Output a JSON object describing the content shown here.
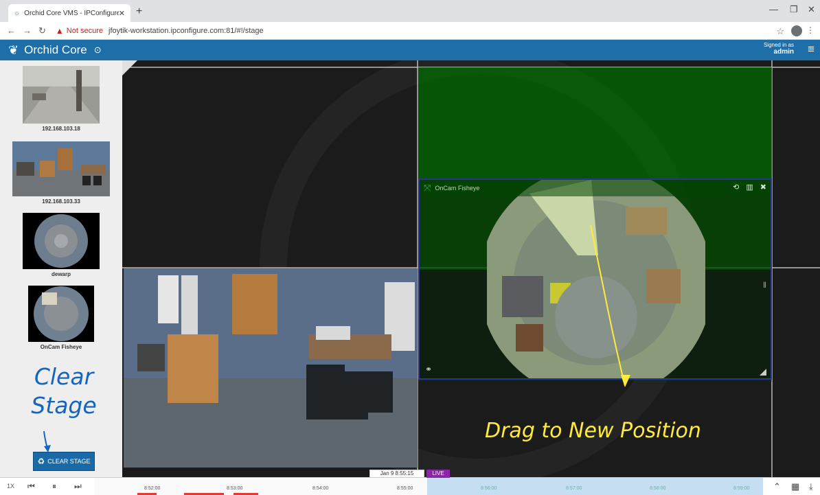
{
  "browser": {
    "tab_title": "Orchid Core VMS - IPConfigure, I",
    "tab_close": "✕",
    "new_tab": "+",
    "security_label": "Not secure",
    "url": "jfoytik-workstation.ipconfigure.com:81/#!/stage"
  },
  "header": {
    "app_title": "Orchid Core",
    "signed_in_label": "Signed in as",
    "user": "admin"
  },
  "sidebar": {
    "cameras": [
      {
        "label": "192.168.103.18"
      },
      {
        "label": "192.168.103.33"
      },
      {
        "label": "dewarp"
      },
      {
        "label": "OnCam Fisheye"
      }
    ],
    "clear_stage_button": "CLEAR STAGE"
  },
  "stage": {
    "panel_title": "OnCam Fisheye"
  },
  "annotations": {
    "clear_line1": "Clear",
    "clear_line2": "Stage",
    "drag": "Drag to New Position"
  },
  "timeline": {
    "speed": "1X",
    "current_time": "Jan 9 8:55:15",
    "live_label": "LIVE",
    "ticks": [
      "8:52:00",
      "8:53:00",
      "8:54:00",
      "8:55:00",
      "8:56:00",
      "8:57:00",
      "8:58:00",
      "8:59:00"
    ]
  },
  "colors": {
    "header_blue": "#1e6fa8",
    "annotation_blue": "#1565c0",
    "annotation_yellow": "#ffeb3b",
    "live_purple": "#8e24aa",
    "selection_green": "#006e00"
  }
}
